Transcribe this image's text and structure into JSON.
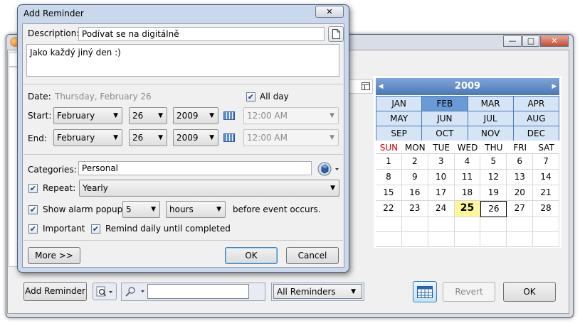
{
  "main_window": {
    "caption_buttons": {
      "minimize": "—",
      "maximize": "□",
      "close": "✕"
    },
    "month_view": {
      "year": "2009",
      "months": [
        "JAN",
        "FEB",
        "MAR",
        "APR",
        "MAY",
        "JUN",
        "JUL",
        "AUG",
        "SEP",
        "OCT",
        "NOV",
        "DEC"
      ],
      "selected_month": "FEB",
      "weekdays": [
        "SUN",
        "MON",
        "TUE",
        "WED",
        "THU",
        "FRI",
        "SAT"
      ],
      "weeks": [
        [
          "1",
          "2",
          "3",
          "4",
          "5",
          "6",
          "7"
        ],
        [
          "8",
          "9",
          "10",
          "11",
          "12",
          "13",
          "14"
        ],
        [
          "15",
          "16",
          "17",
          "18",
          "19",
          "20",
          "21"
        ],
        [
          "22",
          "23",
          "24",
          "25",
          "26",
          "27",
          "28"
        ],
        [
          "",
          "",
          "",
          "",
          "",
          "",
          ""
        ],
        [
          "",
          "",
          "",
          "",
          "",
          "",
          ""
        ]
      ],
      "today": "25",
      "selected_day": "26"
    },
    "toolbar": {
      "add_reminder_label": "Add Reminder",
      "search_value": "",
      "filter_selected": "All Reminders",
      "revert_label": "Revert",
      "ok_label": "OK"
    }
  },
  "dialog": {
    "title": "Add Reminder",
    "close_glyph": "✕",
    "description_label": "Description:",
    "description_value": "Podívat se na digitálně",
    "notes_value": "Jako každý jiný den :)",
    "date_label": "Date:",
    "date_value": "Thursday, February 26",
    "all_day_label": "All day",
    "all_day_checked": true,
    "start_label": "Start:",
    "start": {
      "month": "February",
      "day": "26",
      "year": "2009",
      "time": "12:00 AM"
    },
    "end_label": "End:",
    "end": {
      "month": "February",
      "day": "26",
      "year": "2009",
      "time": "12:00 AM"
    },
    "categories_label": "Categories:",
    "categories_value": "Personal",
    "repeat_label": "Repeat:",
    "repeat_checked": true,
    "repeat_value": "Yearly",
    "alarm_label": "Show alarm popup",
    "alarm_checked": true,
    "alarm_amount": "5",
    "alarm_unit": "hours",
    "alarm_suffix": "before event occurs.",
    "important_label": "Important",
    "important_checked": true,
    "remind_daily_label": "Remind daily until completed",
    "remind_daily_checked": true,
    "more_label": "More >>",
    "ok_label": "OK",
    "cancel_label": "Cancel"
  },
  "colors": {
    "year_bar": "#4a78b8",
    "month_cell": "#d6e5f5",
    "today_highlight": "#fff79a",
    "sunday": "#d40000"
  }
}
